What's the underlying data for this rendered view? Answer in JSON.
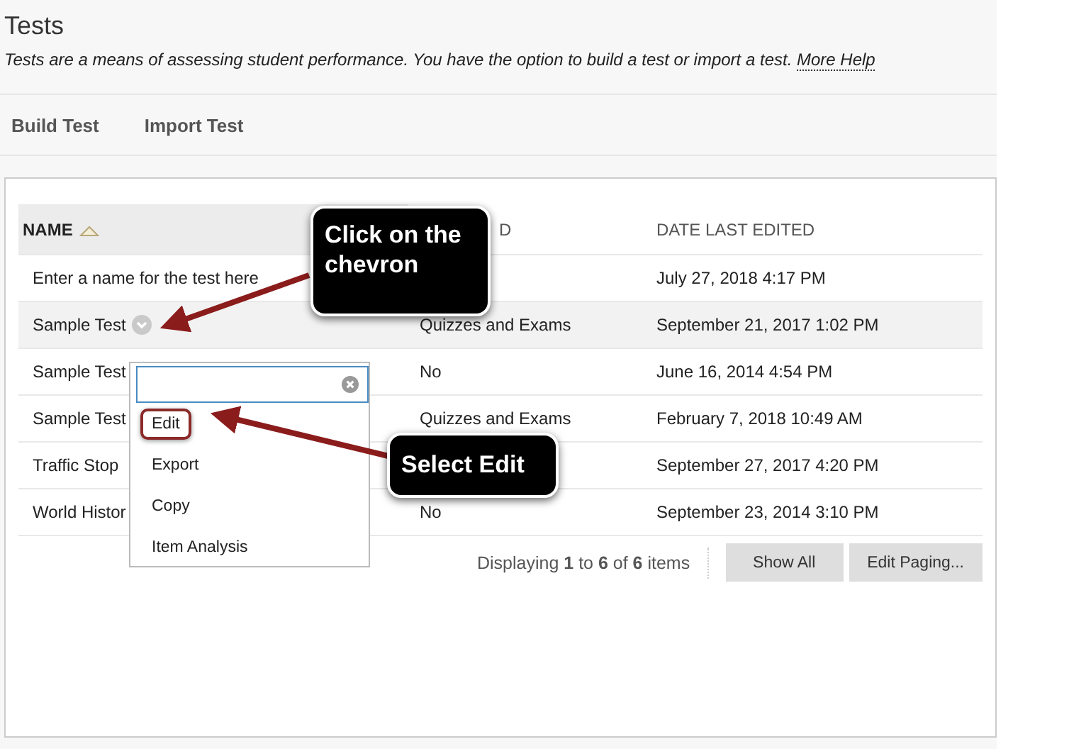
{
  "page": {
    "title": "Tests",
    "description": "Tests are a means of assessing student performance. You have the option to build a test or import a test.",
    "help_link": "More Help"
  },
  "actions": [
    "Build Test",
    "Import Test"
  ],
  "table": {
    "columns": [
      {
        "label": "NAME",
        "sorted": true
      },
      {
        "label": "D",
        "sorted": false
      },
      {
        "label": "DATE LAST EDITED",
        "sorted": false
      }
    ],
    "rows": [
      {
        "name": "Enter a name for the test here",
        "column_2": "",
        "date": "July 27, 2018 4:17 PM",
        "highlighted": false,
        "menu_button": false
      },
      {
        "name": "Sample Test",
        "column_2": "Quizzes and Exams",
        "date": "September 21, 2017 1:02 PM",
        "highlighted": true,
        "menu_button": true
      },
      {
        "name": "Sample Test",
        "column_2": "No",
        "date": "June 16, 2014 4:54 PM",
        "highlighted": false,
        "menu_button": false
      },
      {
        "name": "Sample Test",
        "column_2": "Quizzes and Exams",
        "date": "February 7, 2018 10:49 AM",
        "highlighted": false,
        "menu_button": false
      },
      {
        "name": "Traffic Stop",
        "column_2": "",
        "date": "September 27, 2017 4:20 PM",
        "highlighted": false,
        "menu_button": false
      },
      {
        "name": "World Histor",
        "column_2": "No",
        "date": "September 23, 2014 3:10 PM",
        "highlighted": false,
        "menu_button": false
      }
    ],
    "paging": "Displaying **1** to **6** of **6** items",
    "buttons": [
      "Show All",
      "Edit Paging..."
    ]
  },
  "menu": {
    "items": [
      {
        "label": "Edit",
        "circled": true
      },
      {
        "label": "Export",
        "circled": false
      },
      {
        "label": "Copy",
        "circled": false
      },
      {
        "label": "Item Analysis",
        "circled": false
      }
    ]
  },
  "callouts": [
    {
      "text": "Click on the chevron"
    },
    {
      "text": "Select Edit"
    }
  ]
}
